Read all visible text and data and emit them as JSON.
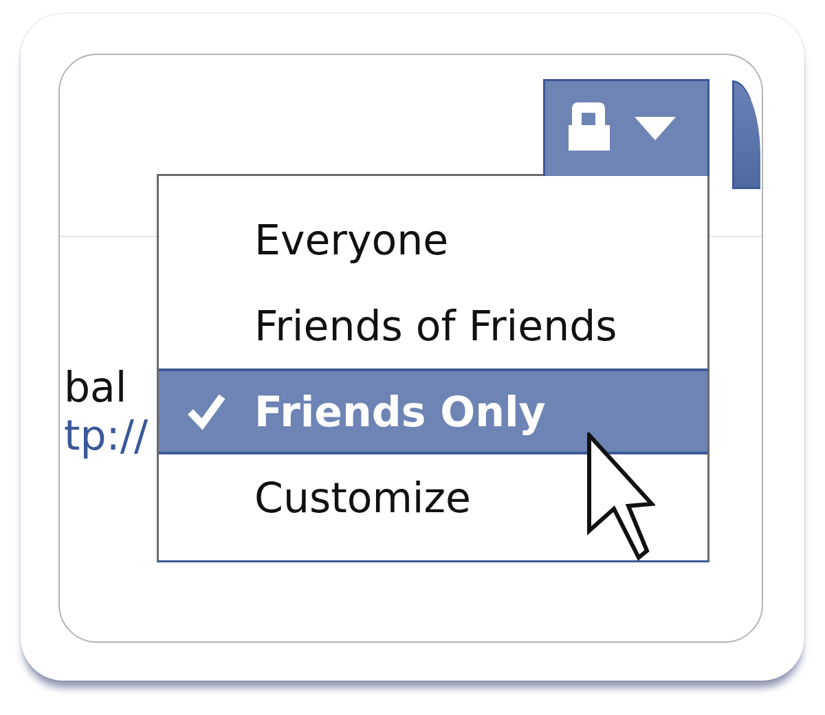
{
  "content": [
    {
      "kind": "text",
      "text": "bal"
    },
    {
      "kind": "link",
      "text": "tp://"
    }
  ],
  "menu": {
    "open": true,
    "items": [
      {
        "label": "Everyone",
        "selected": false
      },
      {
        "label": "Friends of Friends",
        "selected": false
      },
      {
        "label": "Friends Only",
        "selected": true
      },
      {
        "label": "Customize",
        "selected": false
      }
    ]
  }
}
